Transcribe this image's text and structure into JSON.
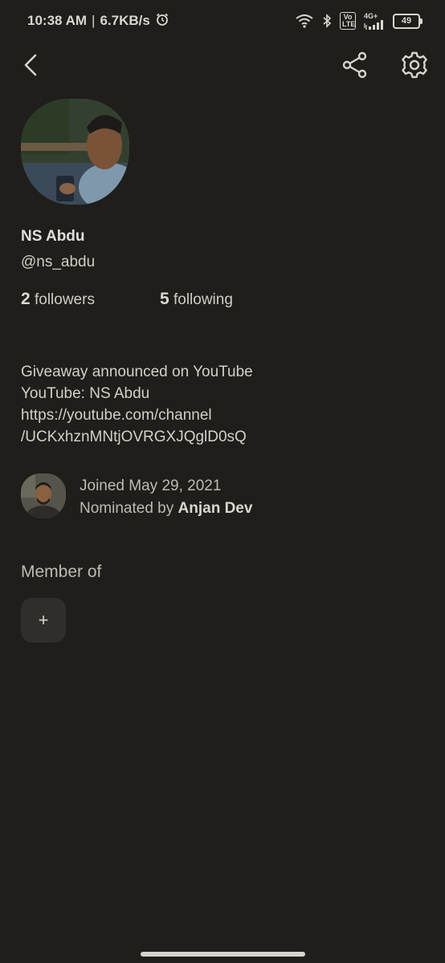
{
  "status_bar": {
    "time": "10:38 AM",
    "separator": "|",
    "speed": "6.7KB/s",
    "network": "4G+",
    "volte": "Vo LTE",
    "battery": "49"
  },
  "profile": {
    "name": "NS Abdu",
    "handle": "@ns_abdu",
    "followers_count": "2",
    "followers_label": "followers",
    "following_count": "5",
    "following_label": "following",
    "bio_lines": [
      "Giveaway announced on YouTube",
      "YouTube: NS Abdu",
      "https://youtube.com/channel",
      "/UCKxhznMNtjOVRGXJQglD0sQ"
    ],
    "joined": "Joined May 29, 2021",
    "nominated_prefix": "Nominated by",
    "nominator": "Anjan Dev"
  },
  "clubs": {
    "title": "Member of",
    "add_symbol": "+"
  },
  "icons": {
    "back": "chevron-left-icon",
    "share": "share-icon",
    "settings": "gear-icon",
    "alarm": "alarm-icon",
    "wifi": "wifi-icon",
    "bluetooth": "bluetooth-icon",
    "signal": "signal-icon"
  },
  "colors": {
    "background": "#1f1e1b",
    "text": "#d6d4cf",
    "button_bg": "#2f2e2b"
  }
}
